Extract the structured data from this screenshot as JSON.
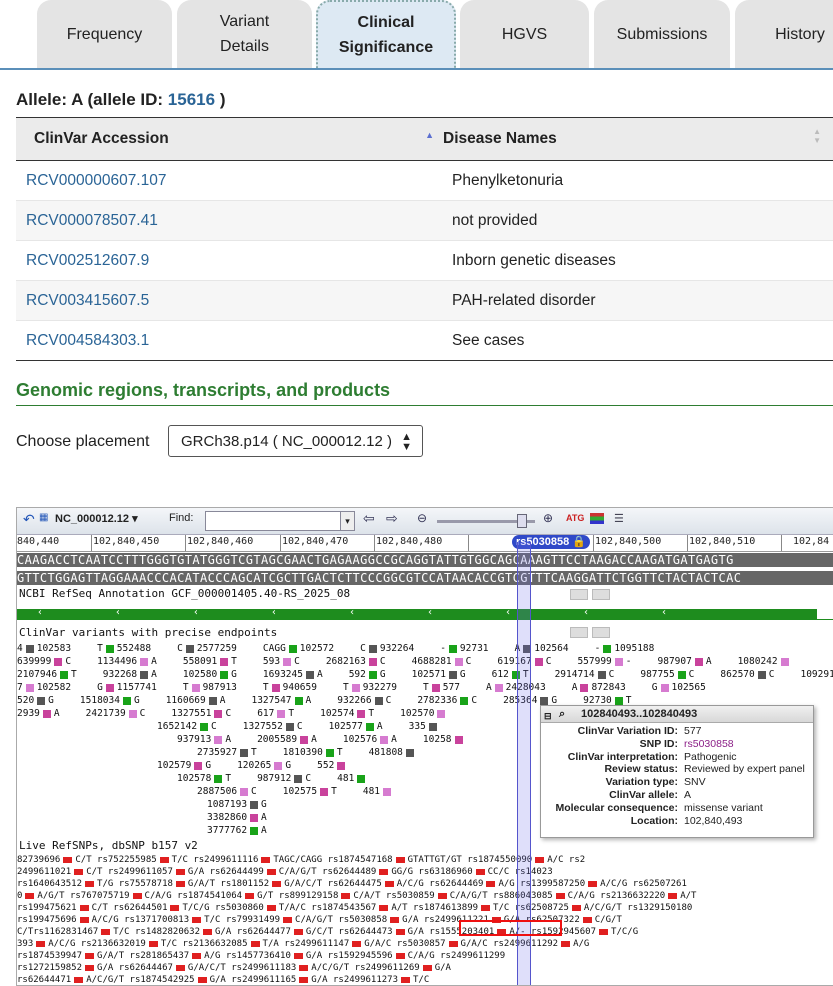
{
  "tabs": [
    {
      "label": "Frequency"
    },
    {
      "label": "Variant Details"
    },
    {
      "label": "Clinical Significance"
    },
    {
      "label": "HGVS"
    },
    {
      "label": "Submissions"
    },
    {
      "label": "History"
    }
  ],
  "allele": {
    "prefix": "Allele: A (allele ID:",
    "id": "15616",
    "suffix": ")"
  },
  "table": {
    "headers": [
      "ClinVar Accession",
      "Disease Names"
    ],
    "rows": [
      {
        "accession": "RCV000000607.107",
        "disease": "Phenylketonuria"
      },
      {
        "accession": "RCV000078507.41",
        "disease": "not provided"
      },
      {
        "accession": "RCV002512607.9",
        "disease": "Inborn genetic diseases"
      },
      {
        "accession": "RCV003415607.5",
        "disease": "PAH-related disorder"
      },
      {
        "accession": "RCV004584303.1",
        "disease": "See cases"
      }
    ]
  },
  "genomic": {
    "title": "Genomic regions, transcripts, and products",
    "choose_label": "Choose placement",
    "placement": "GRCh38.p14 ( NC_000012.12 )"
  },
  "viewer": {
    "seq_id": "NC_000012.12",
    "find_label": "Find:",
    "ruler": [
      "840,440",
      "102,840,450",
      "102,840,460",
      "102,840,470",
      "102,840,480",
      "102,840,490",
      "102,840,500",
      "102,840,510",
      "102,84"
    ],
    "marker": "rs5030858",
    "seq_top": "CAAGACCTCAATCCTTTGGGTGTATGGGTCGTAGCGAACTGAGAAGGCCGCAGGTATTGTGGCAGCAAAGTTCCTAAGACCAAGATGATGAGTG",
    "seq_bottom": "GTTCTGGAGTTAGGAAACCCACATACCCAGCATCGCTTGACTCTTCCCGGCGTCCATAACACCGTCGTTTCAAGGATTCTGGTTCTACTACTCAC",
    "annotation_title": "NCBI RefSeq Annotation GCF_000001405.40-RS_2025_08",
    "clinvar_title": "ClinVar variants with precise endpoints",
    "dbsnp_title": "Live RefSNPs, dbSNP b157 v2"
  },
  "popup": {
    "title": "102840493..102840493",
    "rows": [
      {
        "k": "ClinVar Variation ID:",
        "v": "577"
      },
      {
        "k": "SNP ID:",
        "v": "rs5030858"
      },
      {
        "k": "ClinVar interpretation:",
        "v": "Pathogenic"
      },
      {
        "k": "Review status:",
        "v": "Reviewed by expert panel"
      },
      {
        "k": "Variation type:",
        "v": "SNV"
      },
      {
        "k": "ClinVar allele:",
        "v": "A"
      },
      {
        "k": "Molecular consequence:",
        "v": "missense variant"
      },
      {
        "k": "Location:",
        "v": "102,840,493"
      }
    ]
  },
  "clinvar_rows": [
    [
      "4",
      "102583",
      "T",
      "552488",
      "C",
      "2577259",
      "CAGG",
      "102572",
      "C",
      "932264",
      "-",
      "92731",
      "A",
      "102564",
      "-",
      "1095188"
    ],
    [
      "639999",
      "C",
      "1134496",
      "A",
      "558091",
      "T",
      "593",
      "C",
      "2682163",
      "C",
      "4688281",
      "C",
      "619167",
      "C",
      "557999",
      "-",
      "987907",
      "A",
      "1080242"
    ],
    [
      "2107946",
      "T",
      "932268",
      "A",
      "102580",
      "G",
      "1693245",
      "A",
      "592",
      "G",
      "102571",
      "G",
      "612",
      "T",
      "2914714",
      "C",
      "987755",
      "C",
      "862570",
      "C",
      "1092911"
    ],
    [
      "7",
      "102582",
      "G",
      "1157741",
      "T",
      "987913",
      "T",
      "940659",
      "T",
      "932279",
      "T",
      "577",
      "A",
      "2428043",
      "A",
      "872843",
      "G",
      "102565"
    ],
    [
      "520",
      "G",
      "1518034",
      "G",
      "1160669",
      "A",
      "1327547",
      "A",
      "932266",
      "C",
      "2782336",
      "C",
      "285364",
      "G",
      "92730",
      "T"
    ],
    [
      "2939",
      "A",
      "2421739",
      "C",
      "1327551",
      "C",
      "617",
      "T",
      "102574",
      "T",
      "102570"
    ],
    [
      "1652142",
      "C",
      "1327552",
      "C",
      "102577",
      "A",
      "335"
    ],
    [
      "937913",
      "A",
      "2005589",
      "A",
      "102576",
      "A",
      "10258"
    ],
    [
      "2735927",
      "T",
      "1810390",
      "T",
      "481808"
    ],
    [
      "102579",
      "G",
      "120265",
      "G",
      "552"
    ],
    [
      "102578",
      "T",
      "987912",
      "C",
      "481"
    ],
    [
      "2887506",
      "C",
      "102575",
      "T",
      "481"
    ],
    [
      "1087193",
      "G"
    ],
    [
      "3382860",
      "A"
    ],
    [
      "3777762",
      "A"
    ]
  ],
  "dbsnp_rows": [
    "82739696 C/T  rs752255985 T/C   rs2499611116 TAGC/CAGG   rs1874547168 GTATTGT/GT  rs1874550090 A/C  rs2",
    "2499611021 C/T  rs2499611057 G/A  rs62644499 C/A/G/T   rs62644489 GG/G   rs63186960 CC/C  rs14023",
    "rs1640643512 T/G  rs75578718 G/A/T  rs1801152 G/A/C/T  rs62644475 A/C/G  rs62644469 A/G  rs1399587250 A/C/G  rs62507261",
    "0 A/G/T  rs767075719 C/A/G  rs1874541064 G/T  rs899129158 C/A/T  rs5030859 C/A/G/T  rs886043085 C/A/G  rs2136632220 A/T",
    "rs199475621 C/T  rs62644501 T/C/G  rs5030860 T/A/C  rs1874543567 A/T  rs1874613899 T/C  rs62508725 A/C/G/T  rs1329150180",
    "rs199475696 A/C/G  rs1371700813 T/C  rs79931499 C/A/G/T  rs5030858 G/A  rs2499611221 G/A  rs62507322 C/G/T",
    "C/T  rs1162831467 T/C  rs1482820632 G/A  rs62644477 G/C/T  rs62644473 G/A  rs1555203401 A/-  rs1592945607 T/C/G",
    "393 A/C/G  rs2136632019 T/C  rs2136632085 T/A  rs2499611147 G/A/C  rs5030857 G/A/C  rs2499611292 A/G",
    "rs1874539947 G/A/T  rs281865437 A/G  rs1457736410 G/A  rs1592945596 C/A/G  rs2499611299",
    "rs1272159852 G/A  rs62644467 G/A/C/T  rs2499611183 A/C/G/T  rs2499611269 G/A",
    "rs62644471 A/C/G/T  rs1874542925 G/A  rs2499611165 G/A  rs2499611273 T/C"
  ]
}
